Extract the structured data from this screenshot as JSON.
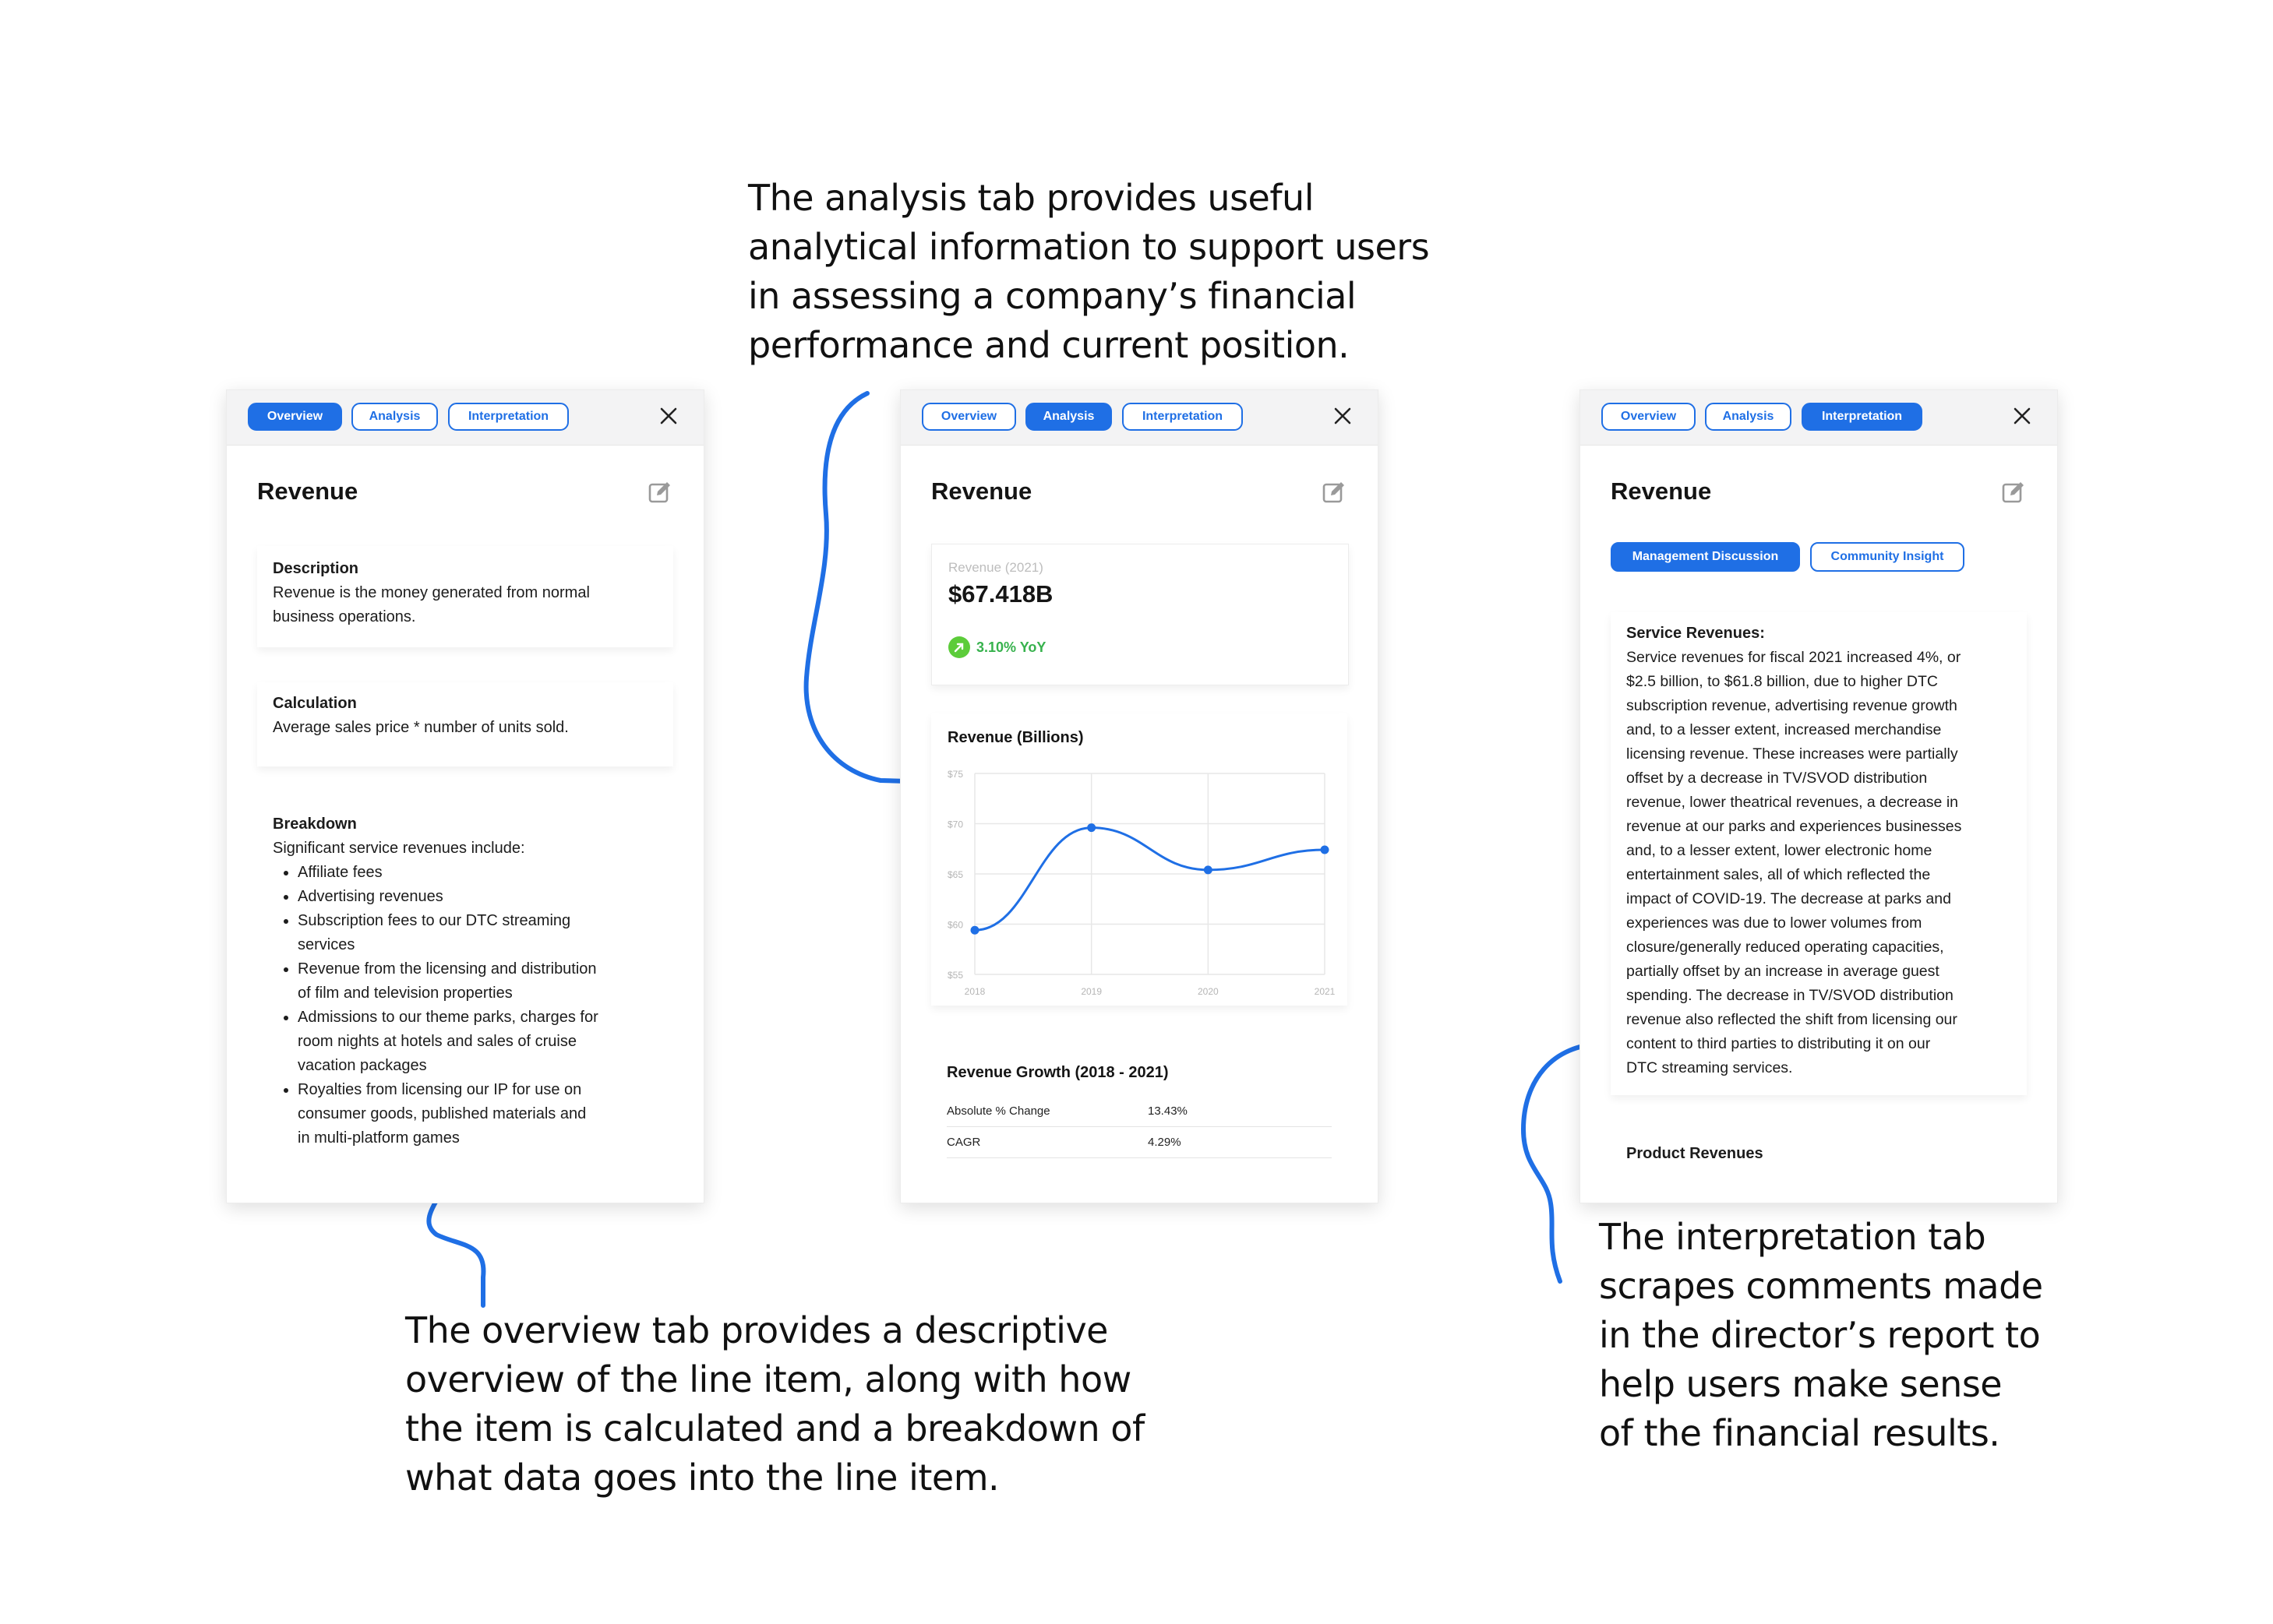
{
  "annotations": {
    "analysis": [
      "The analysis tab provides useful",
      "analytical information to support users",
      "in assessing a company’s financial",
      "performance and current position."
    ],
    "overview": [
      "The overview tab provides a descriptive",
      "overview of the line item, along with how",
      "the item is calculated and a breakdown of",
      "what data goes into the line item."
    ],
    "interpretation": [
      "The interpretation tab",
      "scrapes comments made",
      "in the director’s report to",
      "help users make sense",
      "of the financial results."
    ]
  },
  "tabs": {
    "overview": "Overview",
    "analysis": "Analysis",
    "interpretation": "Interpretation"
  },
  "item_title": "Revenue",
  "overview_panel": {
    "description_heading": "Description",
    "description_text": [
      "Revenue is the money generated from normal",
      "business operations."
    ],
    "calculation_heading": "Calculation",
    "calculation_text": "Average sales price * number of units sold.",
    "breakdown_heading": "Breakdown",
    "breakdown_intro": "Significant service revenues include:",
    "breakdown_items": [
      [
        "Affiliate fees"
      ],
      [
        "Advertising revenues"
      ],
      [
        "Subscription fees to our DTC streaming",
        "services"
      ],
      [
        "Revenue from the licensing and distribution",
        "of film and television properties"
      ],
      [
        "Admissions to our theme parks, charges for",
        "room nights at hotels and sales of cruise",
        "vacation packages"
      ],
      [
        "Royalties from licensing our IP for use on",
        "consumer goods, published materials and",
        "in multi-platform games"
      ]
    ]
  },
  "analysis_panel": {
    "stat_label": "Revenue (2021)",
    "stat_value": "$67.418B",
    "yoy": "3.10% YoY",
    "growth_title": "Revenue Growth (2018 - 2021)",
    "growth_rows": [
      {
        "label": "Absolute % Change",
        "value": "13.43%"
      },
      {
        "label": "CAGR",
        "value": "4.29%"
      }
    ]
  },
  "chart_data": {
    "type": "line",
    "title": "Revenue (Billions)",
    "x": [
      "2018",
      "2019",
      "2020",
      "2021"
    ],
    "series": [
      {
        "values": [
          59.4,
          69.6,
          65.4,
          67.4
        ]
      }
    ],
    "y_ticks": [
      "$55",
      "$60",
      "$65",
      "$70",
      "$75"
    ],
    "ylim": [
      55,
      75
    ],
    "grid": true,
    "color": "#1f6fe5"
  },
  "interpretation_panel": {
    "subtabs": {
      "management": "Management Discussion",
      "community": "Community Insight"
    },
    "service_heading": "Service Revenues:",
    "service_lines": [
      "Service revenues for fiscal 2021 increased 4%, or",
      "$2.5 billion, to $61.8 billion, due to higher DTC",
      "subscription revenue, advertising revenue growth",
      "and, to a lesser extent, increased merchandise",
      "licensing revenue. These increases were partially",
      "offset by a decrease in TV/SVOD distribution",
      "revenue, lower theatrical revenues, a decrease in",
      "revenue at our parks and experiences businesses",
      "and, to a lesser extent, lower electronic home",
      "entertainment sales, all of which reflected the",
      "impact of COVID-19. The decrease at parks and",
      "experiences was due to lower volumes from",
      "closure/generally reduced operating capacities,",
      "partially offset by an increase in average guest",
      "spending. The decrease in TV/SVOD distribution",
      "revenue also reflected the shift from licensing our",
      "content to third parties to distributing it on our",
      "DTC streaming services."
    ],
    "product_heading": "Product Revenues"
  },
  "colors": {
    "accent": "#1f6fe5",
    "positive": "#5ccc3a"
  }
}
